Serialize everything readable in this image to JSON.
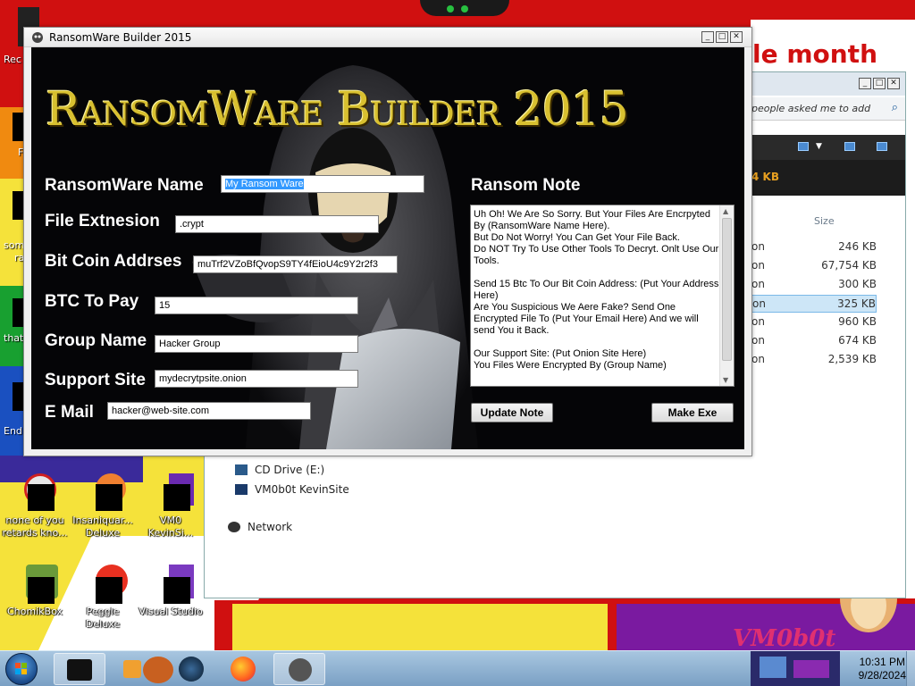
{
  "desktop": {
    "wallpaper_text": "le month",
    "watermark": "VM0b0t",
    "left_partial_labels": [
      "Rec",
      "F",
      "som",
      "ra",
      "that",
      "End"
    ],
    "icons": [
      {
        "label": "none of you retards kno..."
      },
      {
        "label": "Insaniquar... Deluxe"
      },
      {
        "label": "VM0 KevinSi..."
      },
      {
        "label": "ChomikBox"
      },
      {
        "label": "Peggle Deluxe"
      },
      {
        "label": "Visual Studio"
      }
    ]
  },
  "explorer": {
    "search_placeholder": "people asked me to add",
    "top_info": "4 KB",
    "size_header": "Size",
    "rows": [
      {
        "name": "on",
        "size": "246 KB",
        "selected": false
      },
      {
        "name": "on",
        "size": "67,754 KB",
        "selected": false
      },
      {
        "name": "on",
        "size": "300 KB",
        "selected": false
      },
      {
        "name": "on",
        "size": "325 KB",
        "selected": true
      },
      {
        "name": "on",
        "size": "960 KB",
        "selected": false
      },
      {
        "name": "on",
        "size": "674 KB",
        "selected": false
      },
      {
        "name": "on",
        "size": "2,539 KB",
        "selected": false
      }
    ],
    "tree": [
      {
        "label": "CD Drive (E:)"
      },
      {
        "label": "VM0b0t KevinSite"
      },
      {
        "label": "Network"
      }
    ]
  },
  "window": {
    "title": "RansomWare Builder 2015",
    "logo": "RansomWare Builder 2015",
    "fields": {
      "name_label": "RansomWare Name",
      "name_value": "My Ransom Ware",
      "ext_label": "File Extnesion",
      "ext_value": ".crypt",
      "btc_addr_label": "Bit Coin Addrses",
      "btc_addr_value": "muTrf2VZoBfQvopS9TY4fEioU4c9Y2r2f3",
      "btc_pay_label": "BTC To Pay",
      "btc_pay_value": "15",
      "group_label": "Group Name",
      "group_value": "Hacker Group",
      "site_label": "Support Site",
      "site_value": "mydecrytpsite.onion",
      "email_label": "E Mail",
      "email_value": "hacker@web-site.com"
    },
    "note_label": "Ransom Note",
    "note_text": "Uh Oh! We Are So Sorry. But Your Files Are Encrpyted By (RansomWare Name Here).\nBut Do Not Worry! You Can Get Your File Back.\nDo NOT Try To Use Other Tools To Decryt. Onlt Use Our Tools.\n\nSend 15 Btc To Our Bit Coin Address: (Put Your Address Here)\nAre You Suspicious We Aere Fake? Send One Encrypted File To (Put Your Email Here) And we will send You it Back.\n\nOur Support Site: (Put Onion Site Here)\nYou Files Were Encrypted By (Group Name)",
    "update_button": "Update Note",
    "make_button": "Make Exe"
  },
  "taskbar": {
    "time": "10:31 PM",
    "date": "9/28/2024"
  },
  "colors": {
    "wallpaper_red": "#d01010",
    "logo_gold": "#d8c030",
    "selection_blue": "#3399ff"
  }
}
